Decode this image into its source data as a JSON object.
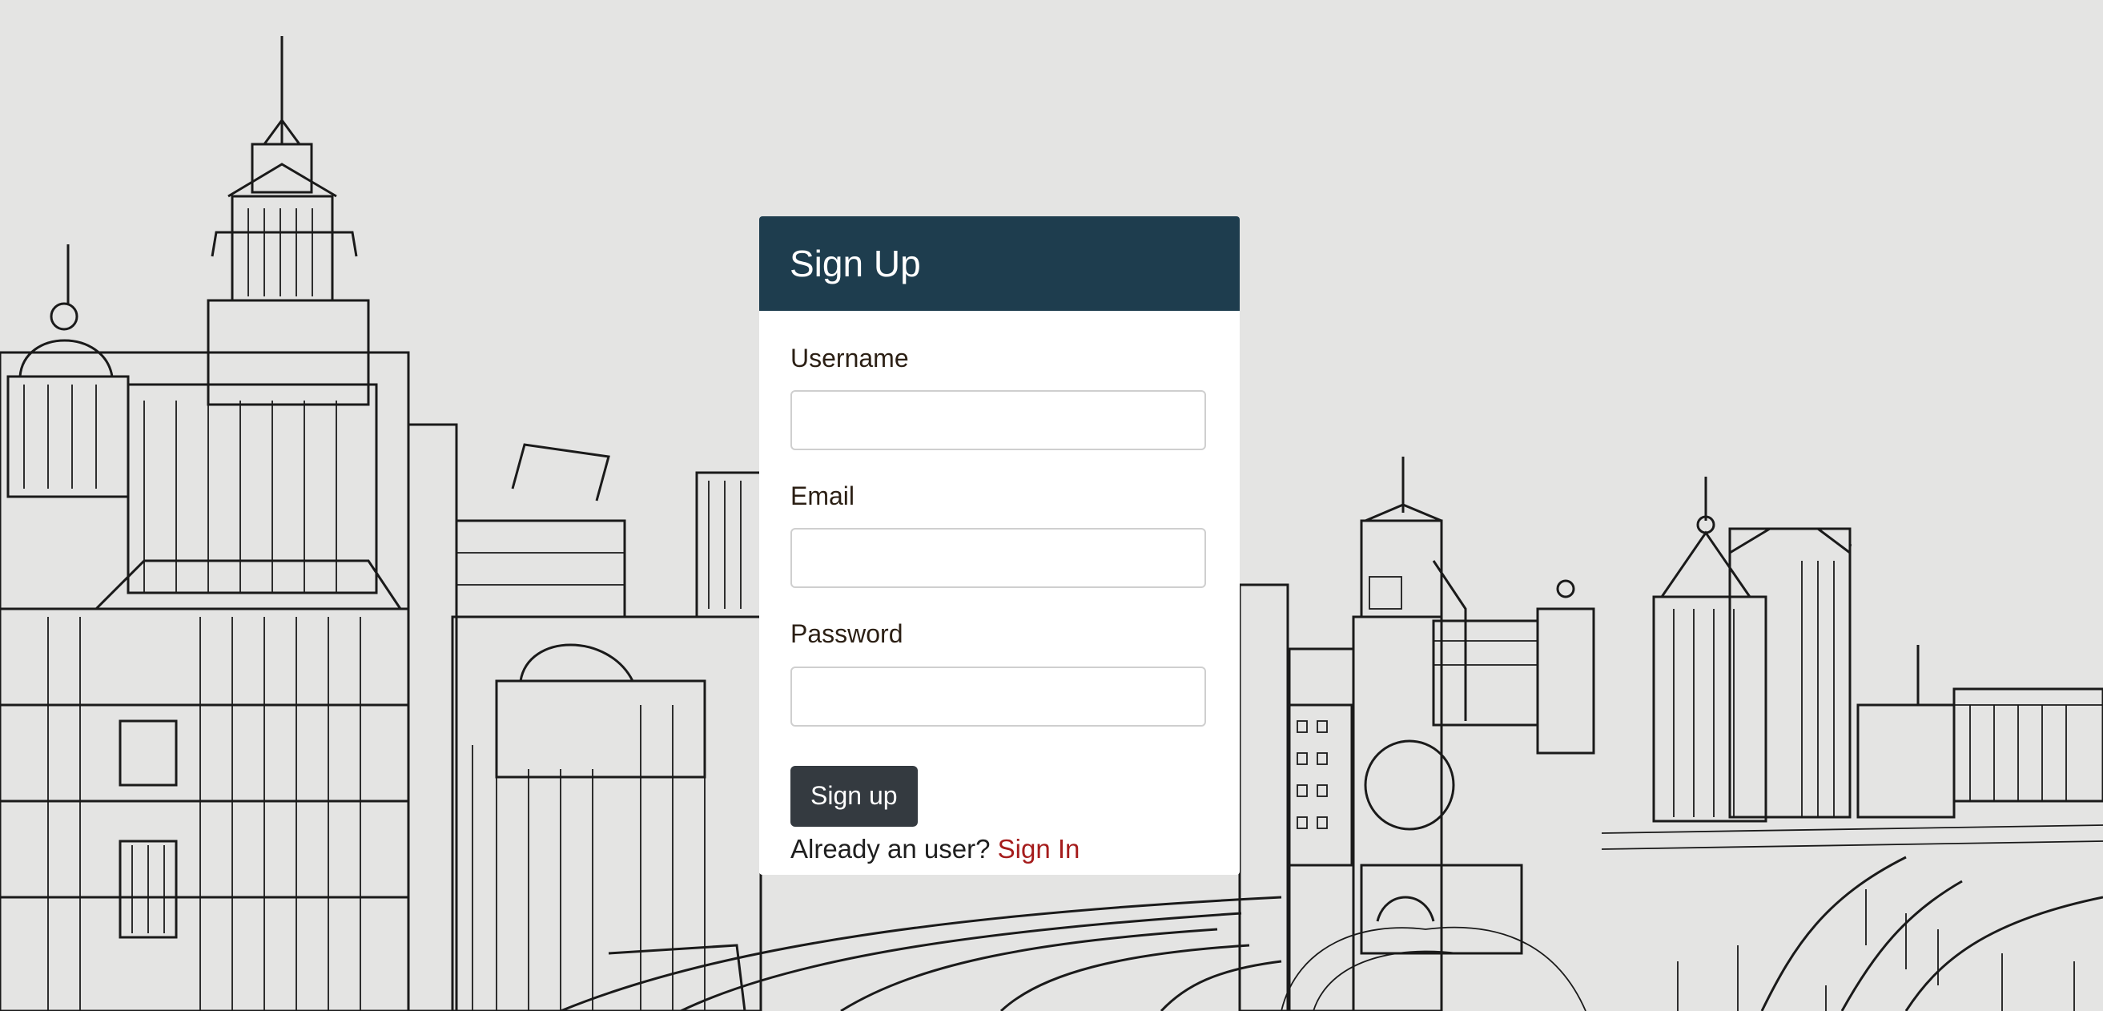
{
  "form": {
    "title": "Sign Up",
    "username_label": "Username",
    "username_value": "",
    "email_label": "Email",
    "email_value": "",
    "password_label": "Password",
    "password_value": "",
    "submit_label": "Sign up",
    "footer_text": "Already an user?",
    "footer_link": "Sign In"
  },
  "colors": {
    "header_bg": "#1e3d4e",
    "button_bg": "#343a40",
    "link": "#a51c1c",
    "background": "#e4e4e3"
  },
  "background": {
    "icon": "city-skyline-sketch"
  }
}
